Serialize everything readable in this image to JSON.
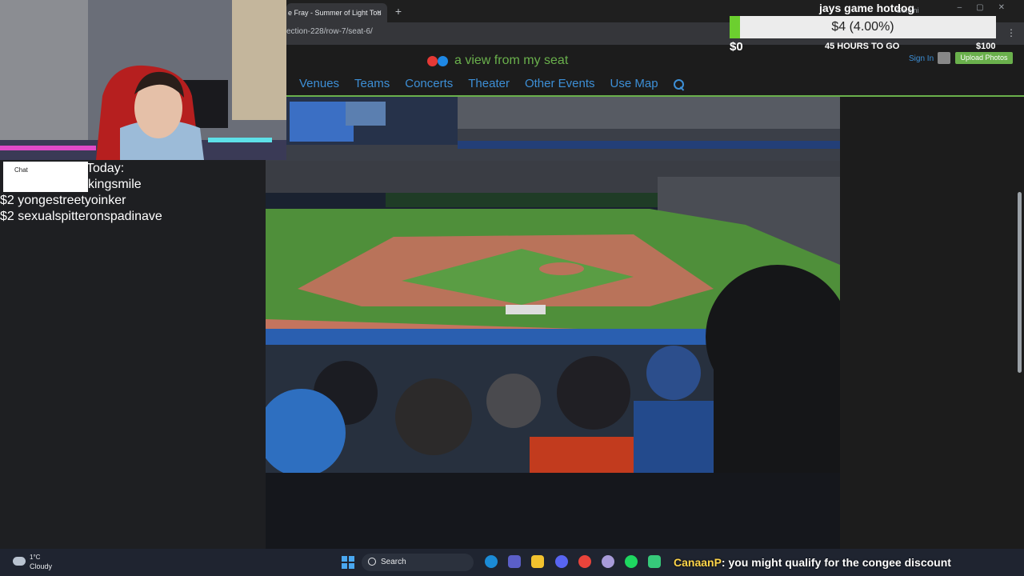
{
  "browser": {
    "tab_title": "e Fray - Summer of Light Tou",
    "tab_close": "×",
    "new_tab": "+",
    "profile": "Gemini",
    "url": "ection-228/row-7/seat-6/",
    "menu": "⋮"
  },
  "site": {
    "logo_text": "a view from my seat",
    "sign_in": "Sign In",
    "upload": "Upload Photos",
    "nav": [
      "Venues",
      "Teams",
      "Concerts",
      "Theater",
      "Other Events",
      "Use Map"
    ]
  },
  "stream_overlay": {
    "goal": {
      "title": "jays game hotdog",
      "label": "$4 (4.00%)",
      "progress": 0.04,
      "min": "$0",
      "time_left": "45 HOURS TO GO",
      "max": "$100"
    },
    "donations": {
      "chat_label": "Chat",
      "header": "Today:",
      "lines": [
        "kingsmile",
        "$2 yongestreetyoinker",
        "$2 sexualspitteronspadinave"
      ]
    },
    "chat": {
      "user": "CanaanP",
      "message": ": you might qualify for the congee discount"
    }
  },
  "taskbar": {
    "temp": "1°C",
    "condition": "Cloudy",
    "search": "Search"
  },
  "colors": {
    "accent_green": "#6ab04c",
    "link_blue": "#3d8fd6",
    "goal_fill": "#6ccf2f"
  }
}
